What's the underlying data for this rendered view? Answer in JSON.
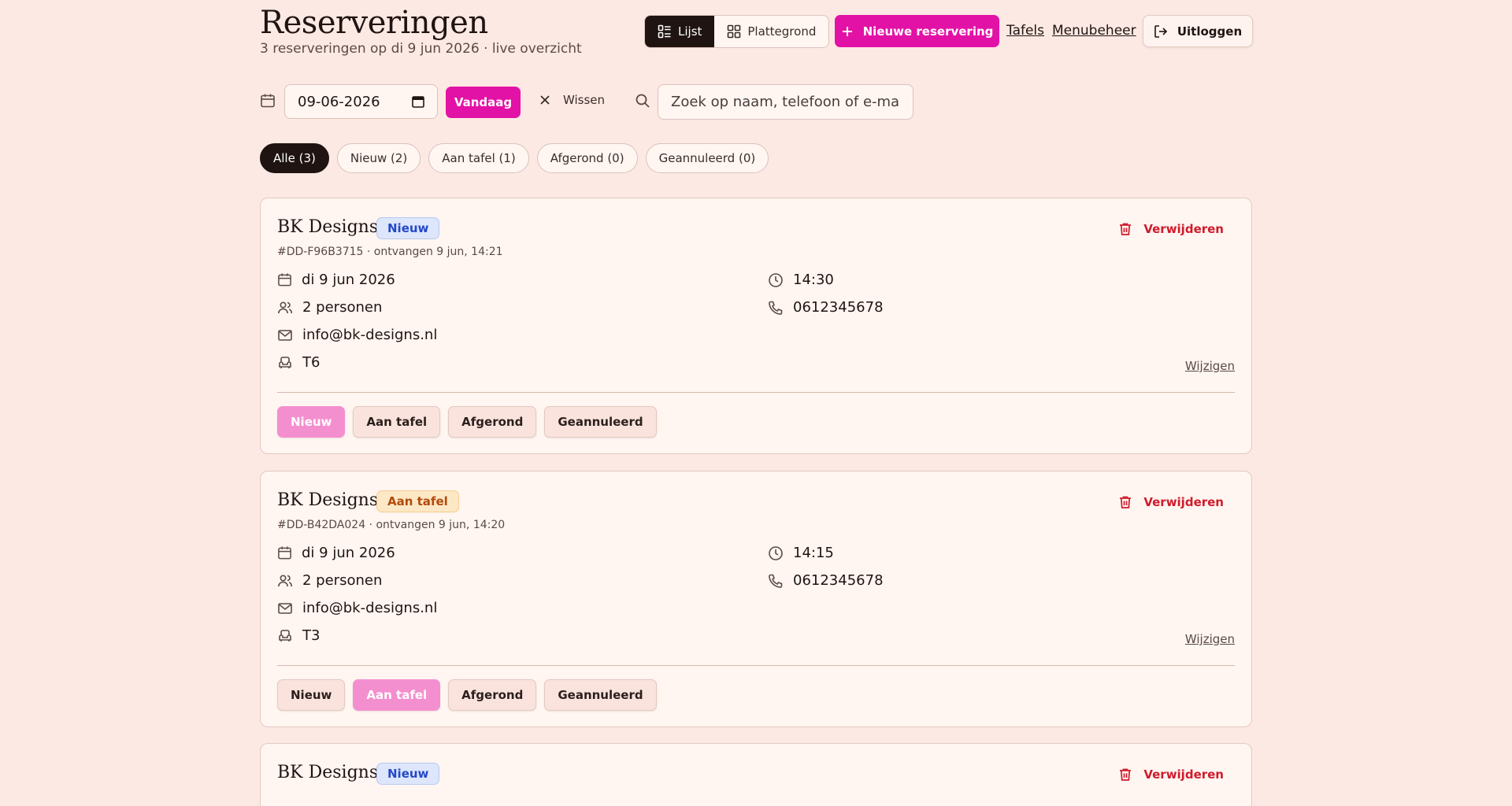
{
  "header": {
    "title": "Reserveringen",
    "subtitle": "3 reserveringen op di 9 jun 2026 · live overzicht",
    "view_list_label": "Lijst",
    "view_floor_label": "Plattegrond",
    "new_reservation_label": "Nieuwe reservering",
    "tables_link": "Tafels",
    "menu_link": "Menubeheer",
    "logout_label": "Uitloggen"
  },
  "filters": {
    "date_value": "09-06-2026",
    "today_label": "Vandaag",
    "clear_label": "Wissen",
    "search_placeholder": "Zoek op naam, telefoon of e-mail"
  },
  "status_chips": [
    {
      "label": "Alle (3)",
      "active": true
    },
    {
      "label": "Nieuw (2)",
      "active": false
    },
    {
      "label": "Aan tafel (1)",
      "active": false
    },
    {
      "label": "Afgerond (0)",
      "active": false
    },
    {
      "label": "Geannuleerd (0)",
      "active": false
    }
  ],
  "status_buttons": [
    "Nieuw",
    "Aan tafel",
    "Afgerond",
    "Geannuleerd"
  ],
  "delete_label": "Verwijderen",
  "edit_label": "Wijzigen",
  "reservations": [
    {
      "name": "BK Designs",
      "status": "Nieuw",
      "meta": "#DD-F96B3715 · ontvangen 9 jun, 14:21",
      "date": "di 9 jun 2026",
      "time": "14:30",
      "guests": "2 personen",
      "phone": "0612345678",
      "email": "info@bk-designs.nl",
      "table": "T6"
    },
    {
      "name": "BK Designs",
      "status": "Aan tafel",
      "meta": "#DD-B42DA024 · ontvangen 9 jun, 14:20",
      "date": "di 9 jun 2026",
      "time": "14:15",
      "guests": "2 personen",
      "phone": "0612345678",
      "email": "info@bk-designs.nl",
      "table": "T3"
    },
    {
      "name": "BK Designs",
      "status": "Nieuw"
    }
  ],
  "colors": {
    "background": "#fde9e3",
    "accent": "#e312a6",
    "danger": "#cf1b2b",
    "badge_new": "#2448c7",
    "badge_seated": "#b24b0b"
  }
}
